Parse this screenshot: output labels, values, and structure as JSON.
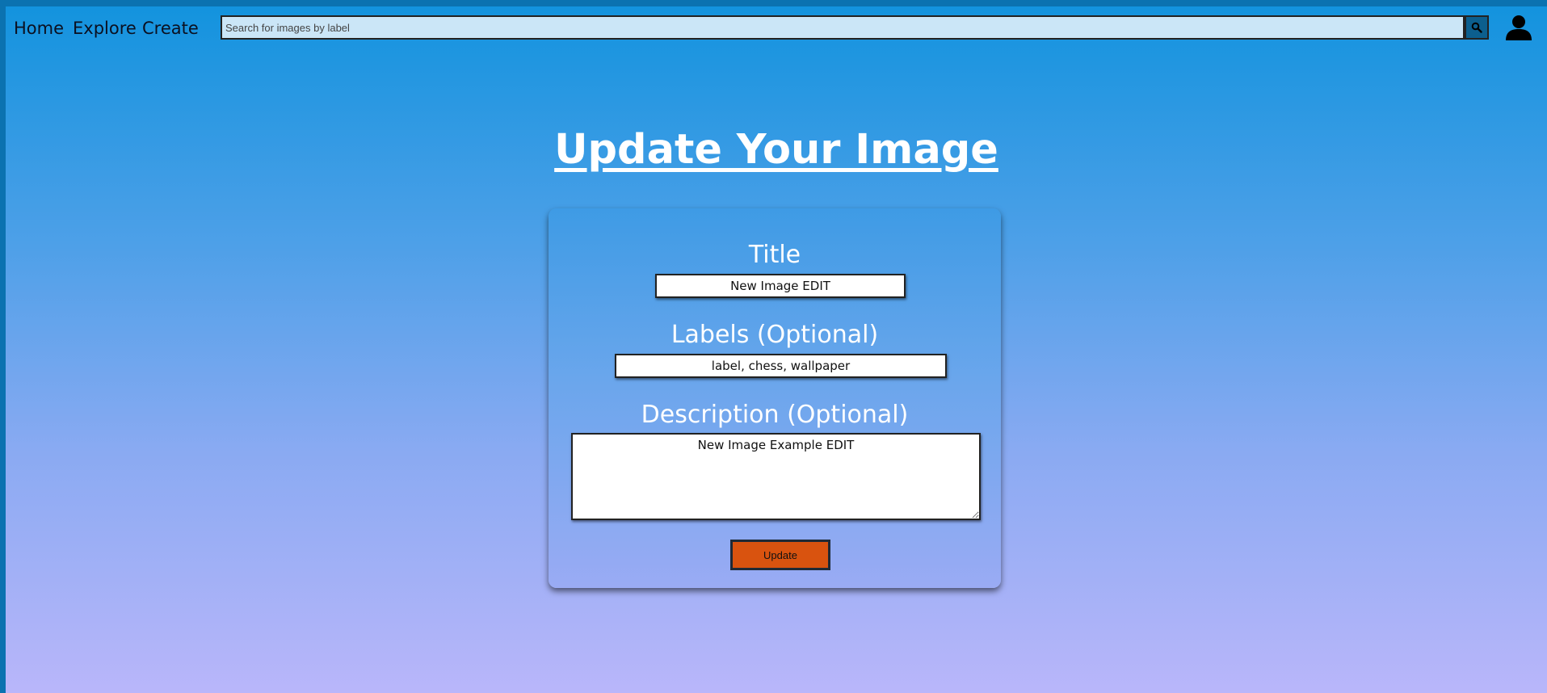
{
  "nav": {
    "links": [
      "Home",
      "Explore",
      "Create"
    ]
  },
  "search": {
    "placeholder": "Search for images by label",
    "icon": "search-icon"
  },
  "user": {
    "icon": "user-icon"
  },
  "page": {
    "title": "Update Your Image"
  },
  "form": {
    "title_label": "Title",
    "title_value": "New Image EDIT",
    "labels_label": "Labels (Optional)",
    "labels_value": "label, chess, wallpaper",
    "description_label": "Description (Optional)",
    "description_value": "New Image Example EDIT",
    "submit_label": "Update"
  },
  "colors": {
    "accent_button": "#d9530f",
    "search_button": "#0c5f8e",
    "gradient_top": "#1393de",
    "gradient_bottom": "#b9b6fa"
  }
}
